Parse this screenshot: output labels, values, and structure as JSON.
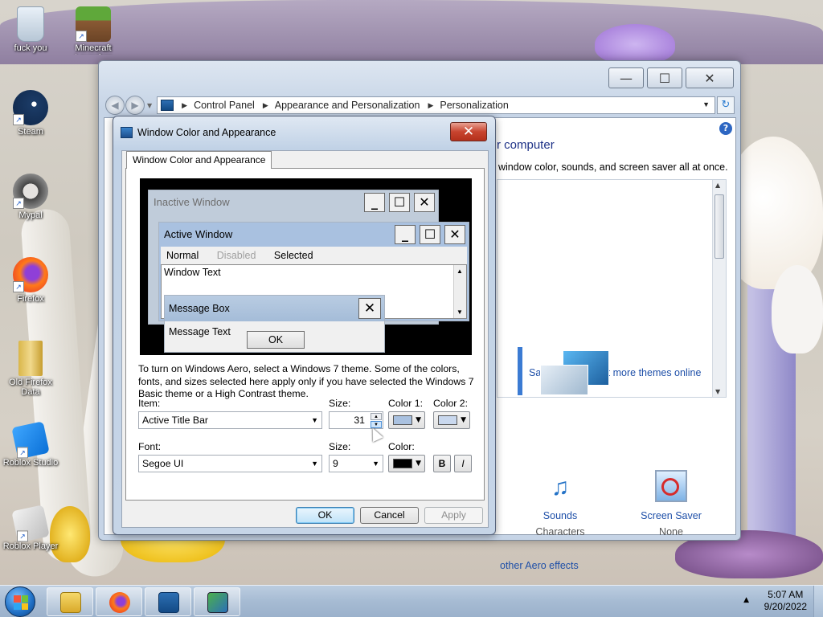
{
  "desktop": {
    "icons": [
      {
        "label": "fuck you",
        "icon": "recycle-bin-icon"
      },
      {
        "label": "Minecraft Launcher",
        "icon": "minecraft-icon"
      },
      {
        "label": "Steam",
        "icon": "steam-icon"
      },
      {
        "label": "Mypal",
        "icon": "mypal-icon"
      },
      {
        "label": "Firefox",
        "icon": "firefox-icon"
      },
      {
        "label": "Old Firefox Data",
        "icon": "folder-icon"
      },
      {
        "label": "Roblox Studio",
        "icon": "roblox-studio-icon"
      },
      {
        "label": "Roblox Player",
        "icon": "roblox-player-icon"
      }
    ]
  },
  "control_panel": {
    "breadcrumb": [
      "Control Panel",
      "Appearance and Personalization",
      "Personalization"
    ],
    "heading": "r computer",
    "description": "window color, sounds, and screen saver all at once.",
    "save_theme": "Save theme",
    "get_more_themes": "Get more themes online",
    "sounds_title": "Sounds",
    "sounds_sub": "Characters",
    "screensaver_title": "Screen Saver",
    "screensaver_sub": "None",
    "aero_link": "other Aero effects"
  },
  "dialog": {
    "title": "Window Color and Appearance",
    "tab_label": "Window Color and Appearance",
    "preview": {
      "inactive_title": "Inactive Window",
      "active_title": "Active Window",
      "menu_normal": "Normal",
      "menu_disabled": "Disabled",
      "menu_selected": "Selected",
      "window_text": "Window Text",
      "message_box_title": "Message Box",
      "message_text": "Message Text",
      "ok_label": "OK"
    },
    "info_text": "To turn on Windows Aero, select a Windows 7 theme.  Some of the colors, fonts, and sizes selected here apply only if you have selected the Windows 7 Basic theme or a High Contrast theme.",
    "item_label": "Item:",
    "item_value": "Active Title Bar",
    "size_label": "Size:",
    "size_value": "31",
    "color1_label": "Color 1:",
    "color1_value": "#a9c1e0",
    "color2_label": "Color 2:",
    "color2_value": "#c9d8ee",
    "font_label": "Font:",
    "font_value": "Segoe UI",
    "font_size_label": "Size:",
    "font_size_value": "9",
    "font_color_label": "Color:",
    "font_color_value": "#000000",
    "bold_label": "B",
    "italic_label": "I",
    "ok_button": "OK",
    "cancel_button": "Cancel",
    "apply_button": "Apply"
  },
  "taskbar": {
    "items": [
      "file-explorer-icon",
      "firefox-icon",
      "control-panel-icon",
      "display-settings-icon"
    ],
    "time": "5:07 AM",
    "date": "9/20/2022"
  }
}
